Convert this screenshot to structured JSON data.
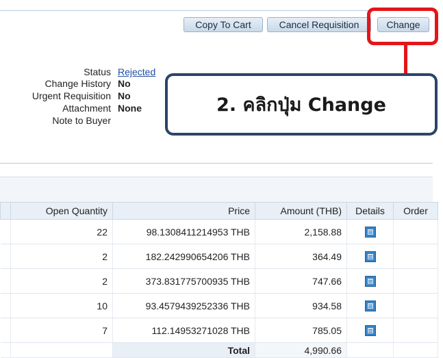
{
  "toolbar": {
    "copy_to_cart": "Copy To Cart",
    "cancel_requisition": "Cancel Requisition",
    "change": "Change"
  },
  "details": {
    "status_label": "Status",
    "status_value": "Rejected",
    "change_history_label": "Change History",
    "change_history_value": "No",
    "urgent_label": "Urgent Requisition",
    "urgent_value": "No",
    "attachment_label": "Attachment",
    "attachment_value": "None",
    "note_label": "Note to Buyer"
  },
  "callout": {
    "text": "2. คลิกปุ่ม Change"
  },
  "table": {
    "columns": [
      "Open Quantity",
      "Price",
      "Amount (THB)",
      "Details",
      "Order"
    ],
    "rows": [
      {
        "open_quantity": "22",
        "price": "98.1308411214953 THB",
        "amount": "2,158.88"
      },
      {
        "open_quantity": "2",
        "price": "182.242990654206 THB",
        "amount": "364.49"
      },
      {
        "open_quantity": "2",
        "price": "373.831775700935 THB",
        "amount": "747.66"
      },
      {
        "open_quantity": "10",
        "price": "93.4579439252336 THB",
        "amount": "934.58"
      },
      {
        "open_quantity": "7",
        "price": "112.14953271028 THB",
        "amount": "785.05"
      }
    ],
    "total_label": "Total",
    "total_value": "4,990.66"
  },
  "colors": {
    "highlight": "#e3151a",
    "callout_border": "#2c4567",
    "link": "#1f4fa3"
  },
  "icons": {
    "details": "details-icon"
  }
}
